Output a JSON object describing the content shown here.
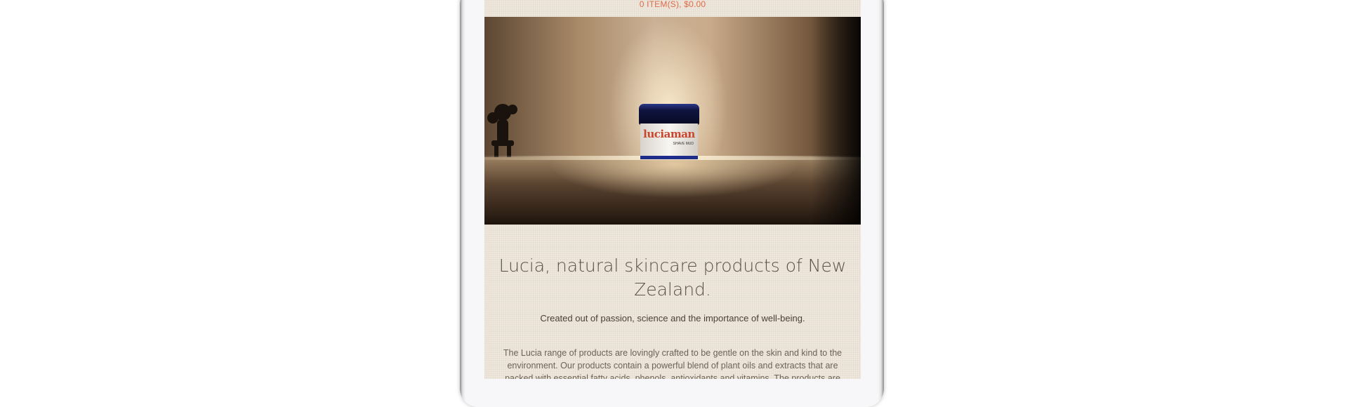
{
  "cart": {
    "summary": "0 ITEM(S), $0.00"
  },
  "hero": {
    "product_brand": "luciaman",
    "product_subtitle": "SHAVE MUD",
    "accent_color": "#e06a4a"
  },
  "intro": {
    "headline": "Lucia, natural skincare products of New Zealand.",
    "tagline": "Created out of passion, science and the importance of well-being.",
    "body": "The Lucia range of products are lovingly crafted to be gentle on the skin and kind to the environment. Our products contain a powerful blend of plant oils and extracts that are packed with essential fatty acids, phenols, antioxidants and vitamins. The products are"
  }
}
